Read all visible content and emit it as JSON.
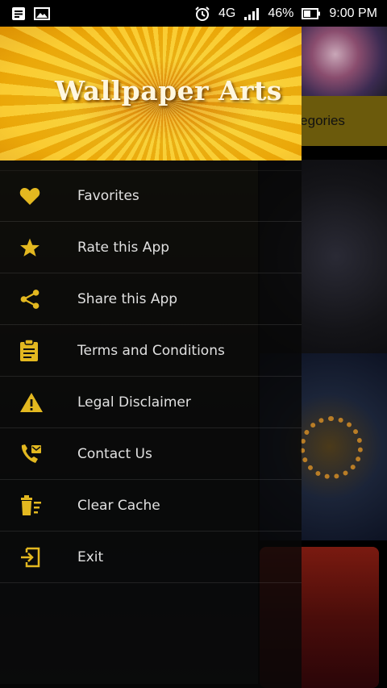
{
  "status_bar": {
    "network": "4G",
    "battery": "46%",
    "time": "9:00 PM",
    "left_icons": [
      "notification-icon",
      "image-icon"
    ],
    "right_icons": [
      "alarm-icon",
      "signal-icon",
      "battery-icon"
    ]
  },
  "background": {
    "tab_label": "ategories"
  },
  "drawer": {
    "title": "Wallpaper Arts",
    "items": [
      {
        "label": "Favorites",
        "icon": "heart-icon"
      },
      {
        "label": "Rate this App",
        "icon": "star-icon"
      },
      {
        "label": "Share this App",
        "icon": "share-icon"
      },
      {
        "label": "Terms and Conditions",
        "icon": "clipboard-icon"
      },
      {
        "label": "Legal Disclaimer",
        "icon": "warning-icon"
      },
      {
        "label": "Contact Us",
        "icon": "contact-phone-icon"
      },
      {
        "label": "Clear Cache",
        "icon": "delete-sweep-icon"
      },
      {
        "label": "Exit",
        "icon": "exit-icon"
      }
    ],
    "icon_color": "#e3b820"
  }
}
